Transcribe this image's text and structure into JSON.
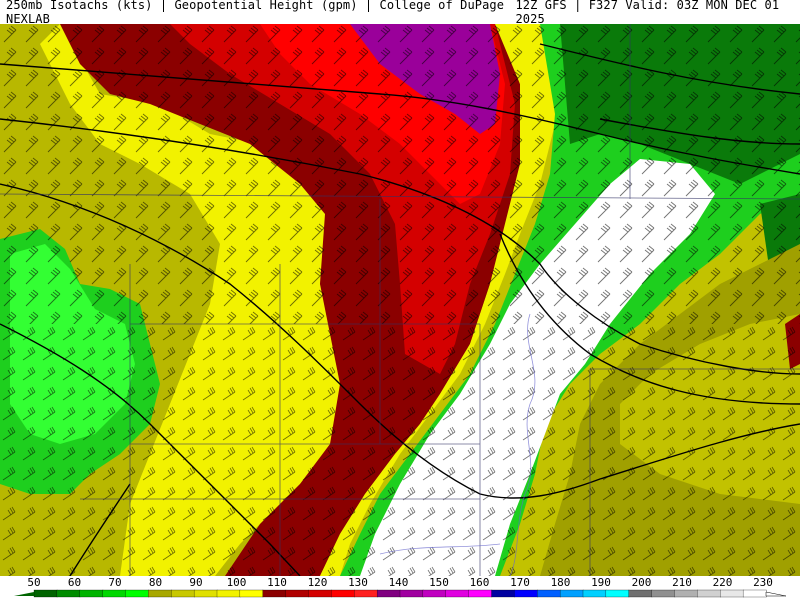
{
  "header": {
    "left_title": "250mb Isotachs (kts) | Geopotential Height (gpm) | College of DuPage NEXLAB",
    "right_title": "12Z GFS | F327 Valid: 03Z MON DEC 01 2025"
  },
  "legend": {
    "ticks": [
      "50",
      "60",
      "70",
      "80",
      "90",
      "100",
      "110",
      "120",
      "130",
      "140",
      "150",
      "160",
      "170",
      "180",
      "190",
      "200",
      "210",
      "220",
      "230"
    ],
    "colors": [
      "#006400",
      "#008c00",
      "#00b400",
      "#00d800",
      "#00ff00",
      "#a8a800",
      "#c8c800",
      "#e0e000",
      "#f2f200",
      "#ffff00",
      "#8b0000",
      "#b00000",
      "#d40000",
      "#ff0000",
      "#ff2020",
      "#800080",
      "#a000a0",
      "#c000c0",
      "#e000e0",
      "#ff00ff",
      "#0000a0",
      "#0000ff",
      "#0060ff",
      "#00a0ff",
      "#00d0ff",
      "#00ffff",
      "#707070",
      "#909090",
      "#b0b0b0",
      "#d0d0d0",
      "#e8e8e8",
      "#ffffff"
    ]
  },
  "map": {
    "fill_colors": {
      "dark_green": "#0a7a0a",
      "green": "#1ecf1e",
      "bright_green": "#33ff33",
      "olive": "#a0a000",
      "dark_yellow": "#c2c200",
      "yellow": "#f2f200",
      "bright_yellow": "#ffff00",
      "dark_red": "#8b0000",
      "red": "#c00000",
      "bright_red": "#ff0000",
      "purple": "#9a009a",
      "white": "#ffffff"
    }
  }
}
